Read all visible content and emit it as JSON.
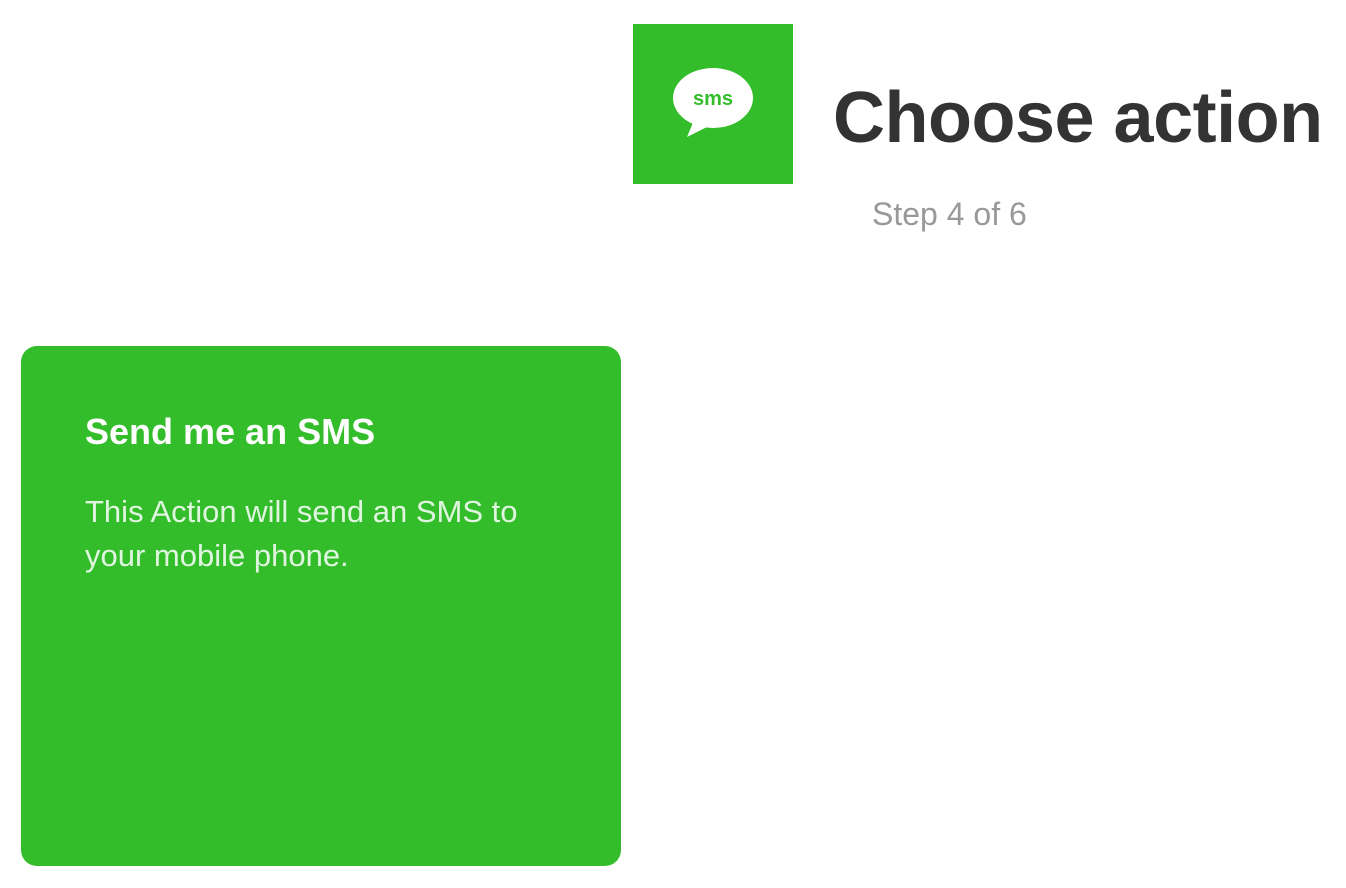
{
  "header": {
    "service_icon": "sms-speech-bubble-icon",
    "service_icon_text": "sms",
    "title": "Choose action",
    "step": "Step 4 of 6"
  },
  "actions": [
    {
      "title": "Send me an SMS",
      "description": "This Action will send an SMS to your mobile phone."
    }
  ],
  "colors": {
    "brand": "#33bd2b",
    "title": "#333333",
    "step": "#999999",
    "card_text": "#ffffff"
  }
}
